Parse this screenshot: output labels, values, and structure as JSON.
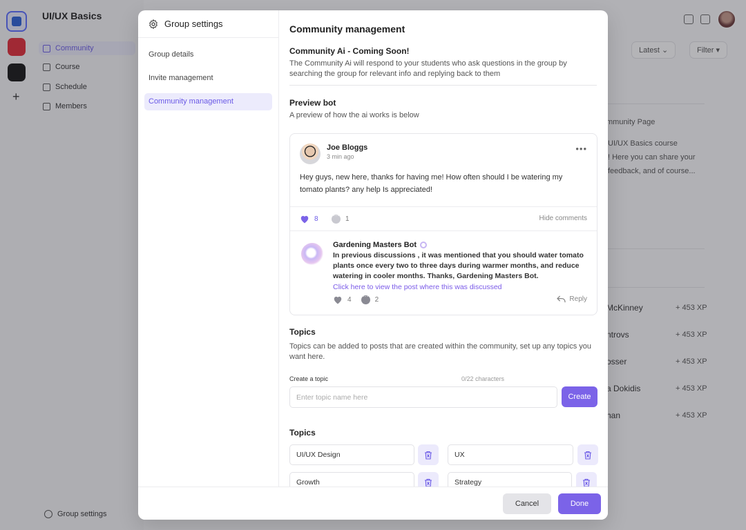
{
  "app": {
    "workspace_title": "UI/UX Basics",
    "nav": [
      {
        "label": "Community",
        "icon": "home-icon",
        "active": true
      },
      {
        "label": "Course",
        "icon": "grid-icon"
      },
      {
        "label": "Schedule",
        "icon": "calendar-icon"
      },
      {
        "label": "Members",
        "icon": "members-icon"
      }
    ],
    "footer_link": "Group settings",
    "sort_label": "Latest",
    "filter_label": "Filter",
    "bg_snippets": [
      "mmunity Page",
      "UI/UX Basics course",
      "! Here you can share your",
      "feedback, and of course..."
    ],
    "leaderboard": [
      {
        "name": "McKinney",
        "xp": "+ 453 XP"
      },
      {
        "name": "ntrovs",
        "xp": "+ 453 XP"
      },
      {
        "name": "osser",
        "xp": "+ 453 XP"
      },
      {
        "name": "a Dokidis",
        "xp": "+ 453 XP"
      },
      {
        "name": "han",
        "xp": "+ 453 XP"
      }
    ]
  },
  "modal": {
    "title": "Group settings",
    "nav": [
      {
        "label": "Group details"
      },
      {
        "label": "Invite management"
      },
      {
        "label": "Community management",
        "active": true
      }
    ],
    "heading": "Community management",
    "ai_title": "Community Ai - Coming Soon!",
    "ai_desc": "The Community Ai will respond to your students who ask questions in the group by searching the group for relevant info and replying back to them",
    "preview_title": "Preview bot",
    "preview_desc": "A preview of how the ai works is below",
    "post": {
      "author": "Joe Bloggs",
      "time": "3 min ago",
      "text": "Hey guys, new here, thanks for having me! How often should I be watering my tomato plants? any help Is appreciated!",
      "likes": "8",
      "comments": "1",
      "hide_comments": "Hide comments"
    },
    "bot": {
      "name": "Gardening Masters Bot",
      "text": "In previous discussions , it was mentioned that you should water tomato plants once every two to three days during warmer months, and reduce watering in cooler months. Thanks, Gardening Masters Bot.",
      "link": "Click here to view the post where this was discussed",
      "likes": "4",
      "comments": "2",
      "reply": "Reply"
    },
    "topics_title": "Topics",
    "topics_desc": "Topics can be added to posts that are created within the community, set up any topics you want here.",
    "create_label": "Create a topic",
    "char_count": "0/22 characters",
    "topic_placeholder": "Enter topic name here",
    "create_button": "Create",
    "topics_list_title": "Topics",
    "topics": [
      "UI/UX Design",
      "UX",
      "Growth",
      "Strategy"
    ],
    "cancel": "Cancel",
    "done": "Done"
  },
  "colors": {
    "accent": "#7b63e8",
    "accent_light": "#ecebfc"
  }
}
